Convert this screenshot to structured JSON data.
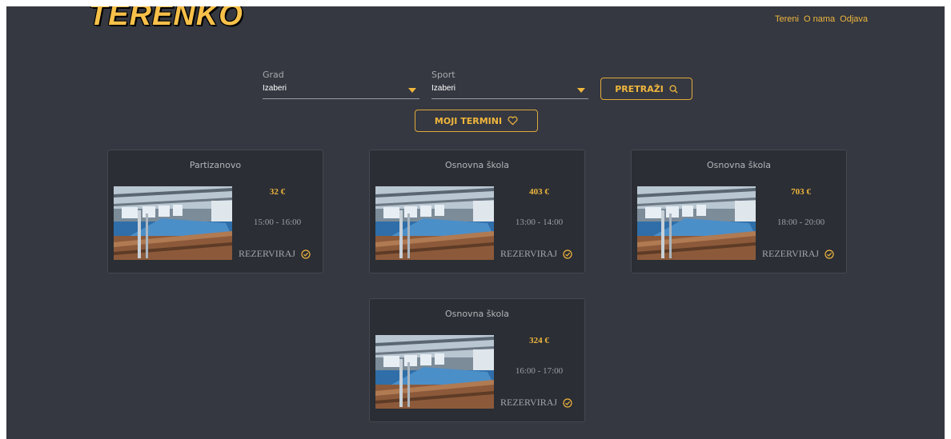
{
  "header": {
    "logo": "TERENKO",
    "nav": [
      {
        "label": "Tereni"
      },
      {
        "label": "O nama"
      },
      {
        "label": "Odjava"
      }
    ]
  },
  "filters": {
    "grad": {
      "label": "Grad",
      "value": "Izaberi"
    },
    "sport": {
      "label": "Sport",
      "value": "Izaberi"
    },
    "search_label": "PRETRAŽI",
    "moji_label": "MOJI TERMINI"
  },
  "colors": {
    "accent": "#f0b63d",
    "background": "#353840",
    "card": "#2b2e34"
  },
  "cards": [
    {
      "title": "Partizanovo",
      "price": "32 €",
      "time": "15:00 - 16:00",
      "action": "REZERVIRAJ"
    },
    {
      "title": "Osnovna škola",
      "price": "403 €",
      "time": "13:00 - 14:00",
      "action": "REZERVIRAJ"
    },
    {
      "title": "Osnovna škola",
      "price": "703 €",
      "time": "18:00 - 20:00",
      "action": "REZERVIRAJ"
    },
    {
      "title": "Osnovna škola",
      "price": "324 €",
      "time": "16:00 - 17:00",
      "action": "REZERVIRAJ"
    }
  ]
}
